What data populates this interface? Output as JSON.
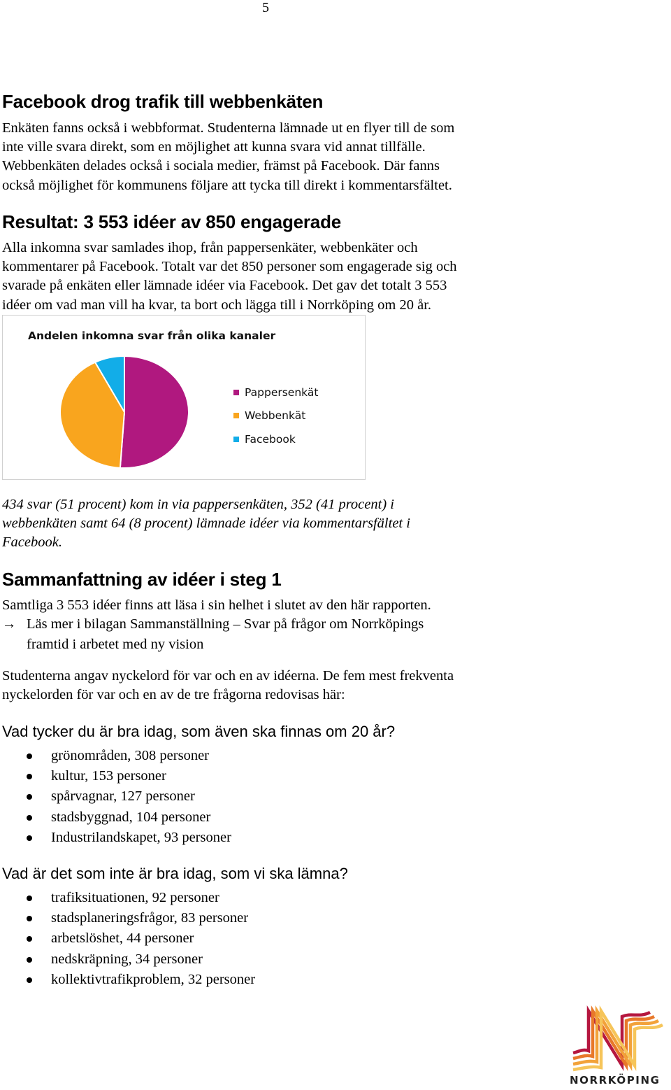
{
  "page_number": "5",
  "sections": {
    "facebook": {
      "heading": "Facebook drog trafik till webbenkäten",
      "lines": [
        "Enkäten fanns också i webbformat. Studenterna lämnade ut en flyer till de som",
        "inte ville svara direkt, som en möjlighet att kunna svara vid annat tillfälle.",
        "Webbenkäten delades också i sociala medier, främst på Facebook. Där fanns",
        "också möjlighet för kommunens följare att tycka till direkt i kommentarsfältet."
      ]
    },
    "resultat": {
      "heading": "Resultat: 3 553 idéer av 850 engagerade",
      "lines": [
        "Alla inkomna svar samlades ihop, från pappersenkäter, webbenkäter och",
        "kommentarer på Facebook. Totalt var det 850 personer som engagerade sig och",
        "svarade på enkäten eller lämnade idéer via Facebook. Det gav det totalt 3 553",
        "idéer om vad man vill ha kvar, ta bort och lägga till i Norrköping om 20 år."
      ]
    },
    "caption": {
      "lines": [
        "434 svar (51 procent) kom in via pappersenkäten, 352 (41 procent) i",
        "webbenkäten samt 64 (8 procent) lämnade idéer via kommentarsfältet i",
        "Facebook."
      ]
    },
    "sammanfattning": {
      "heading": "Sammanfattning av idéer i steg 1",
      "intro": "Samtliga 3 553 idéer finns att läsa i sin helhet i slutet av den här rapporten.",
      "arrow_icon": "→",
      "arrow_lines": [
        "Läs mer i bilagan Sammanställning – Svar på frågor om Norrköpings",
        "framtid i arbetet med ny vision"
      ],
      "keywords_lines": [
        "Studenterna angav nyckelord för var och en av idéerna. De fem mest frekventa",
        "nyckelorden för var och en av de tre frågorna redovisas här:"
      ]
    },
    "question1": {
      "heading": "Vad tycker du är bra idag, som även ska finnas om 20 år?",
      "items": [
        "grönområden, 308 personer",
        "kultur, 153 personer",
        "spårvagnar, 127 personer",
        "stadsbyggnad, 104 personer",
        "Industrilandskapet, 93 personer"
      ]
    },
    "question2": {
      "heading": "Vad är det som inte är bra idag, som vi ska lämna?",
      "items": [
        "trafiksituationen, 92 personer",
        "stadsplaneringsfrågor, 83 personer",
        "arbetslöshet, 44 personer",
        "nedskräpning, 34 personer",
        "kollektivtrafikproblem, 32 personer"
      ]
    }
  },
  "logo": {
    "text": "NORRKÖPING",
    "colors": [
      "#b5173f",
      "#e8782a",
      "#f2a23a",
      "#f6c55a"
    ]
  },
  "chart_data": {
    "type": "pie",
    "title": "Andelen inkomna svar från olika kanaler",
    "categories": [
      "Pappersenkät",
      "Webbenkät",
      "Facebook"
    ],
    "values": [
      434,
      352,
      64
    ],
    "percent": [
      51,
      41,
      8
    ],
    "colors": [
      "#b0187f",
      "#f9a51e",
      "#12ade8"
    ],
    "start_angle_deg": 0,
    "direction": "clockwise",
    "legend": "right"
  }
}
